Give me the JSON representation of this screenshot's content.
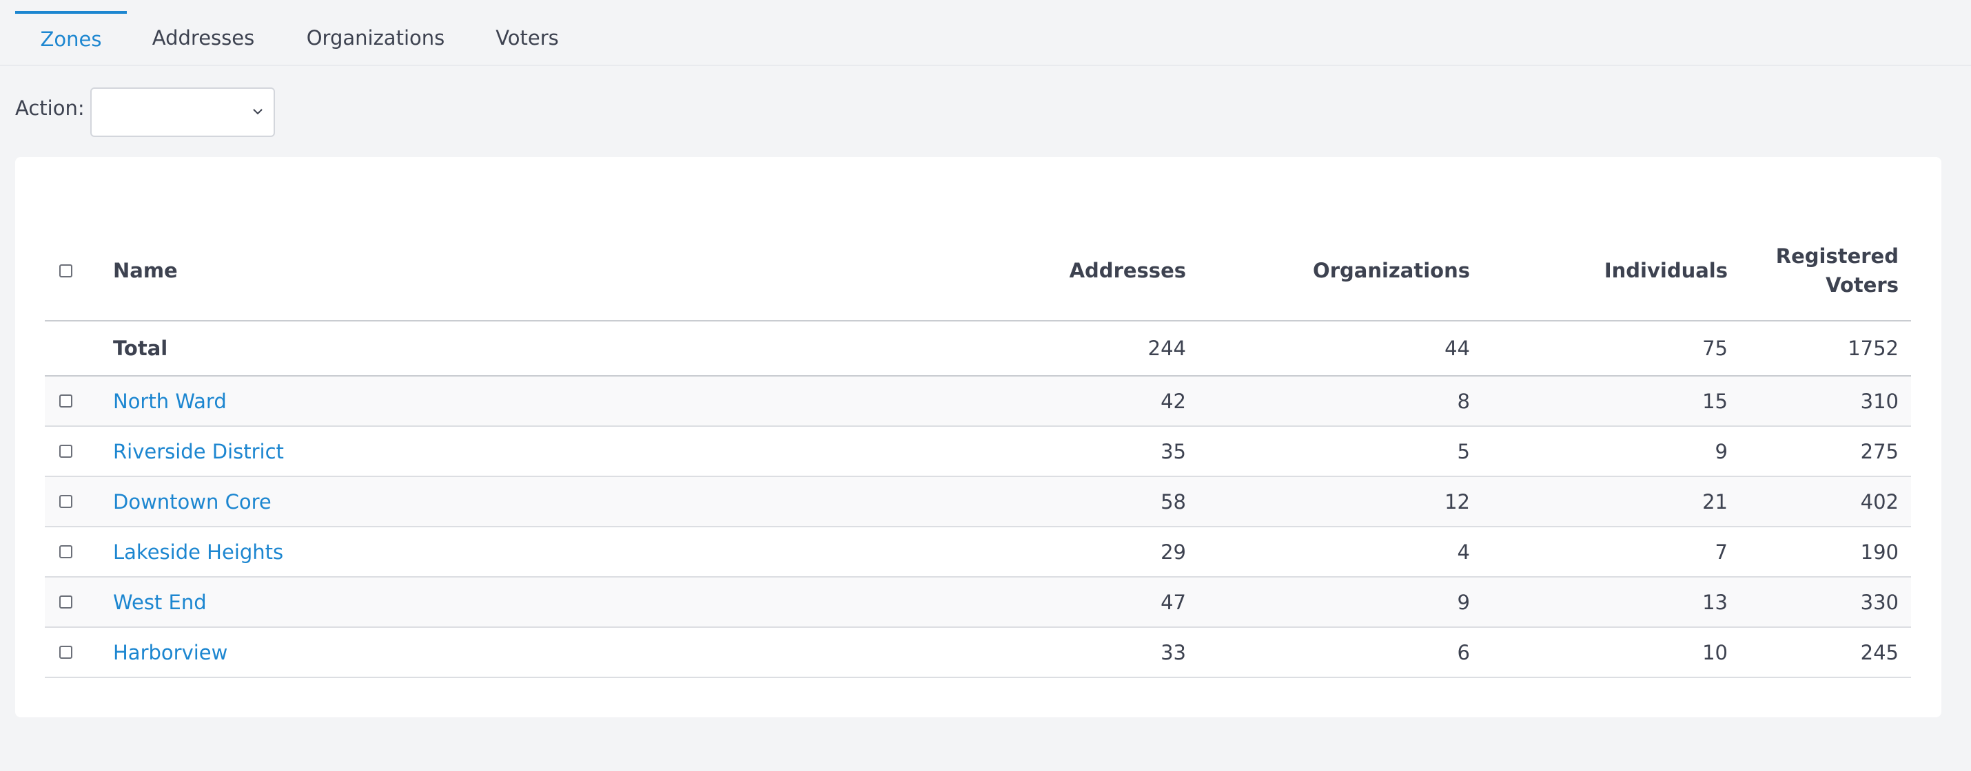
{
  "tabs": [
    {
      "label": "Zones",
      "active": true
    },
    {
      "label": "Addresses",
      "active": false
    },
    {
      "label": "Organizations",
      "active": false
    },
    {
      "label": "Voters",
      "active": false
    }
  ],
  "action": {
    "label": "Action:",
    "selected": ""
  },
  "table": {
    "headers": {
      "name": "Name",
      "addresses": "Addresses",
      "organizations": "Organizations",
      "individuals": "Individuals",
      "registered_voters_line1": "Registered",
      "registered_voters_line2": "Voters"
    },
    "total": {
      "name": "Total",
      "addresses": "244",
      "organizations": "44",
      "individuals": "75",
      "registered_voters": "1752"
    },
    "rows": [
      {
        "name": "North Ward",
        "addresses": "42",
        "organizations": "8",
        "individuals": "15",
        "registered_voters": "310"
      },
      {
        "name": "Riverside District",
        "addresses": "35",
        "organizations": "5",
        "individuals": "9",
        "registered_voters": "275"
      },
      {
        "name": "Downtown Core",
        "addresses": "58",
        "organizations": "12",
        "individuals": "21",
        "registered_voters": "402"
      },
      {
        "name": "Lakeside Heights",
        "addresses": "29",
        "organizations": "4",
        "individuals": "7",
        "registered_voters": "190"
      },
      {
        "name": "West End",
        "addresses": "47",
        "organizations": "9",
        "individuals": "13",
        "registered_voters": "330"
      },
      {
        "name": "Harborview",
        "addresses": "33",
        "organizations": "6",
        "individuals": "10",
        "registered_voters": "245"
      }
    ]
  },
  "colors": {
    "accent": "#1c86d0",
    "text": "#3d4250",
    "page_bg": "#f3f4f6",
    "card_bg": "#ffffff"
  },
  "icons": {
    "select_chevron": "chevron-down-icon",
    "checkbox": "checkbox-icon"
  }
}
